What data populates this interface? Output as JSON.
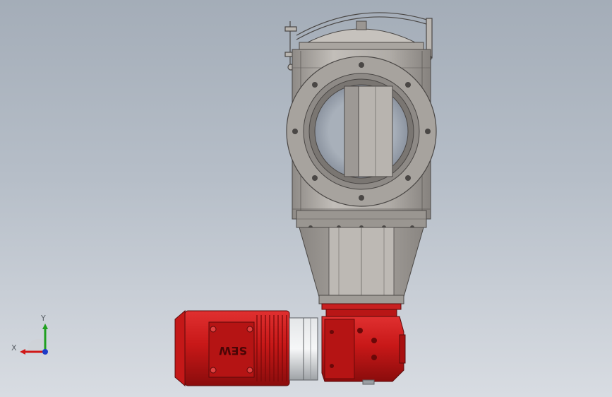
{
  "motor": {
    "brand_mark": "SEW"
  },
  "triad": {
    "x_label": "X",
    "y_label": "Y",
    "x_color": "#d01818",
    "y_color": "#20a020",
    "z_color": "#1e3cc8"
  },
  "colors": {
    "background_top": "#a4adb8",
    "background_bottom": "#d8dce2",
    "steel": "#b4b0ab",
    "steel_dark": "#6e6a66",
    "motor_red": "#c81818",
    "motor_red_dark": "#7c0a0a"
  }
}
